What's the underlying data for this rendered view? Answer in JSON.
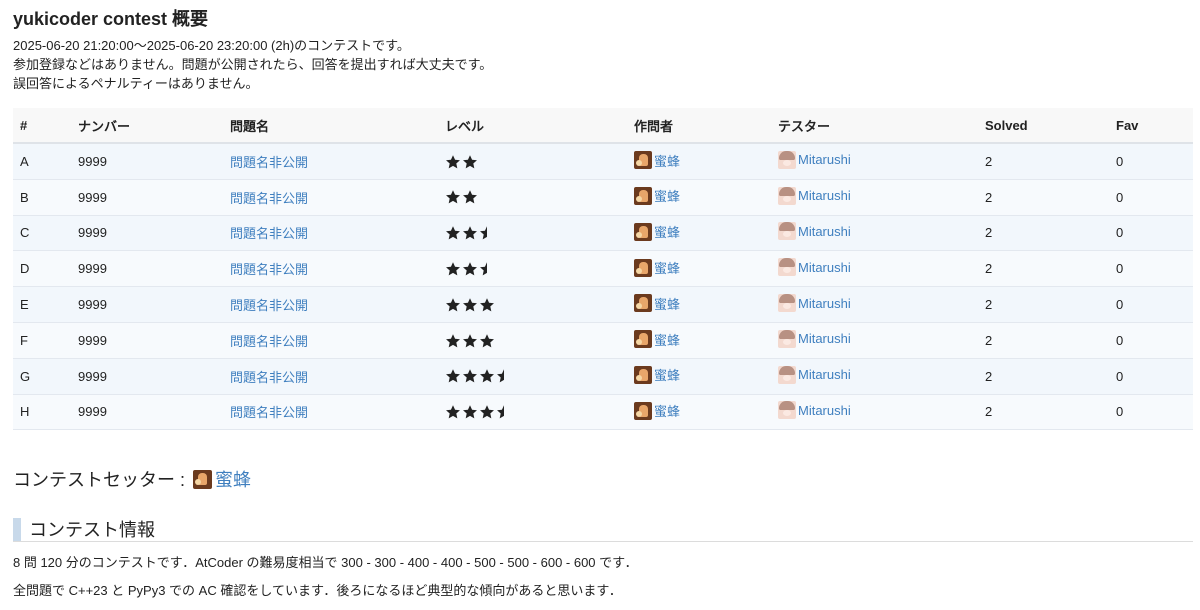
{
  "contest": {
    "title": "yukicoder contest 概要",
    "info_lines": [
      "2025-06-20 21:20:00〜2025-06-20 23:20:00 (2h)のコンテストです。",
      "参加登録などはありません。問題が公開されたら、回答を提出すれば大丈夫です。",
      "誤回答によるペナルティーはありません。"
    ]
  },
  "table": {
    "headers": [
      "#",
      "ナンバー",
      "問題名",
      "レベル",
      "作問者",
      "テスター",
      "Solved",
      "Fav"
    ],
    "rows": [
      {
        "id": "A",
        "number": "9999",
        "name": "問題名非公開",
        "level": 2,
        "author": "蜜蜂",
        "tester": "Mitarushi",
        "solved": "2",
        "fav": "0"
      },
      {
        "id": "B",
        "number": "9999",
        "name": "問題名非公開",
        "level": 2,
        "author": "蜜蜂",
        "tester": "Mitarushi",
        "solved": "2",
        "fav": "0"
      },
      {
        "id": "C",
        "number": "9999",
        "name": "問題名非公開",
        "level": 2.5,
        "author": "蜜蜂",
        "tester": "Mitarushi",
        "solved": "2",
        "fav": "0"
      },
      {
        "id": "D",
        "number": "9999",
        "name": "問題名非公開",
        "level": 2.5,
        "author": "蜜蜂",
        "tester": "Mitarushi",
        "solved": "2",
        "fav": "0"
      },
      {
        "id": "E",
        "number": "9999",
        "name": "問題名非公開",
        "level": 3,
        "author": "蜜蜂",
        "tester": "Mitarushi",
        "solved": "2",
        "fav": "0"
      },
      {
        "id": "F",
        "number": "9999",
        "name": "問題名非公開",
        "level": 3,
        "author": "蜜蜂",
        "tester": "Mitarushi",
        "solved": "2",
        "fav": "0"
      },
      {
        "id": "G",
        "number": "9999",
        "name": "問題名非公開",
        "level": 3.5,
        "author": "蜜蜂",
        "tester": "Mitarushi",
        "solved": "2",
        "fav": "0"
      },
      {
        "id": "H",
        "number": "9999",
        "name": "問題名非公開",
        "level": 3.5,
        "author": "蜜蜂",
        "tester": "Mitarushi",
        "solved": "2",
        "fav": "0"
      }
    ]
  },
  "setter": {
    "label": "コンテストセッター :",
    "name": "蜜蜂"
  },
  "section": {
    "title": "コンテスト情報",
    "para1": "8 問 120 分のコンテストです．AtCoder の難易度相当で 300 - 300 - 400 - 400 - 500 - 500 - 600 - 600 です．",
    "para2": "全問題で C++23 と PyPy3 での AC 確認をしています．後ろになるほど典型的な傾向があると思います．"
  },
  "colors": {
    "link": "#3f7fbf",
    "star": "#222222",
    "row_bg": "#f2f7fc",
    "section_bar": "#c8d9ea"
  },
  "icons": {
    "author_avatar": "bee-avatar-icon",
    "tester_avatar": "mitarushi-avatar-icon",
    "level_star": "star-icon",
    "level_half_star": "half-star-icon"
  }
}
